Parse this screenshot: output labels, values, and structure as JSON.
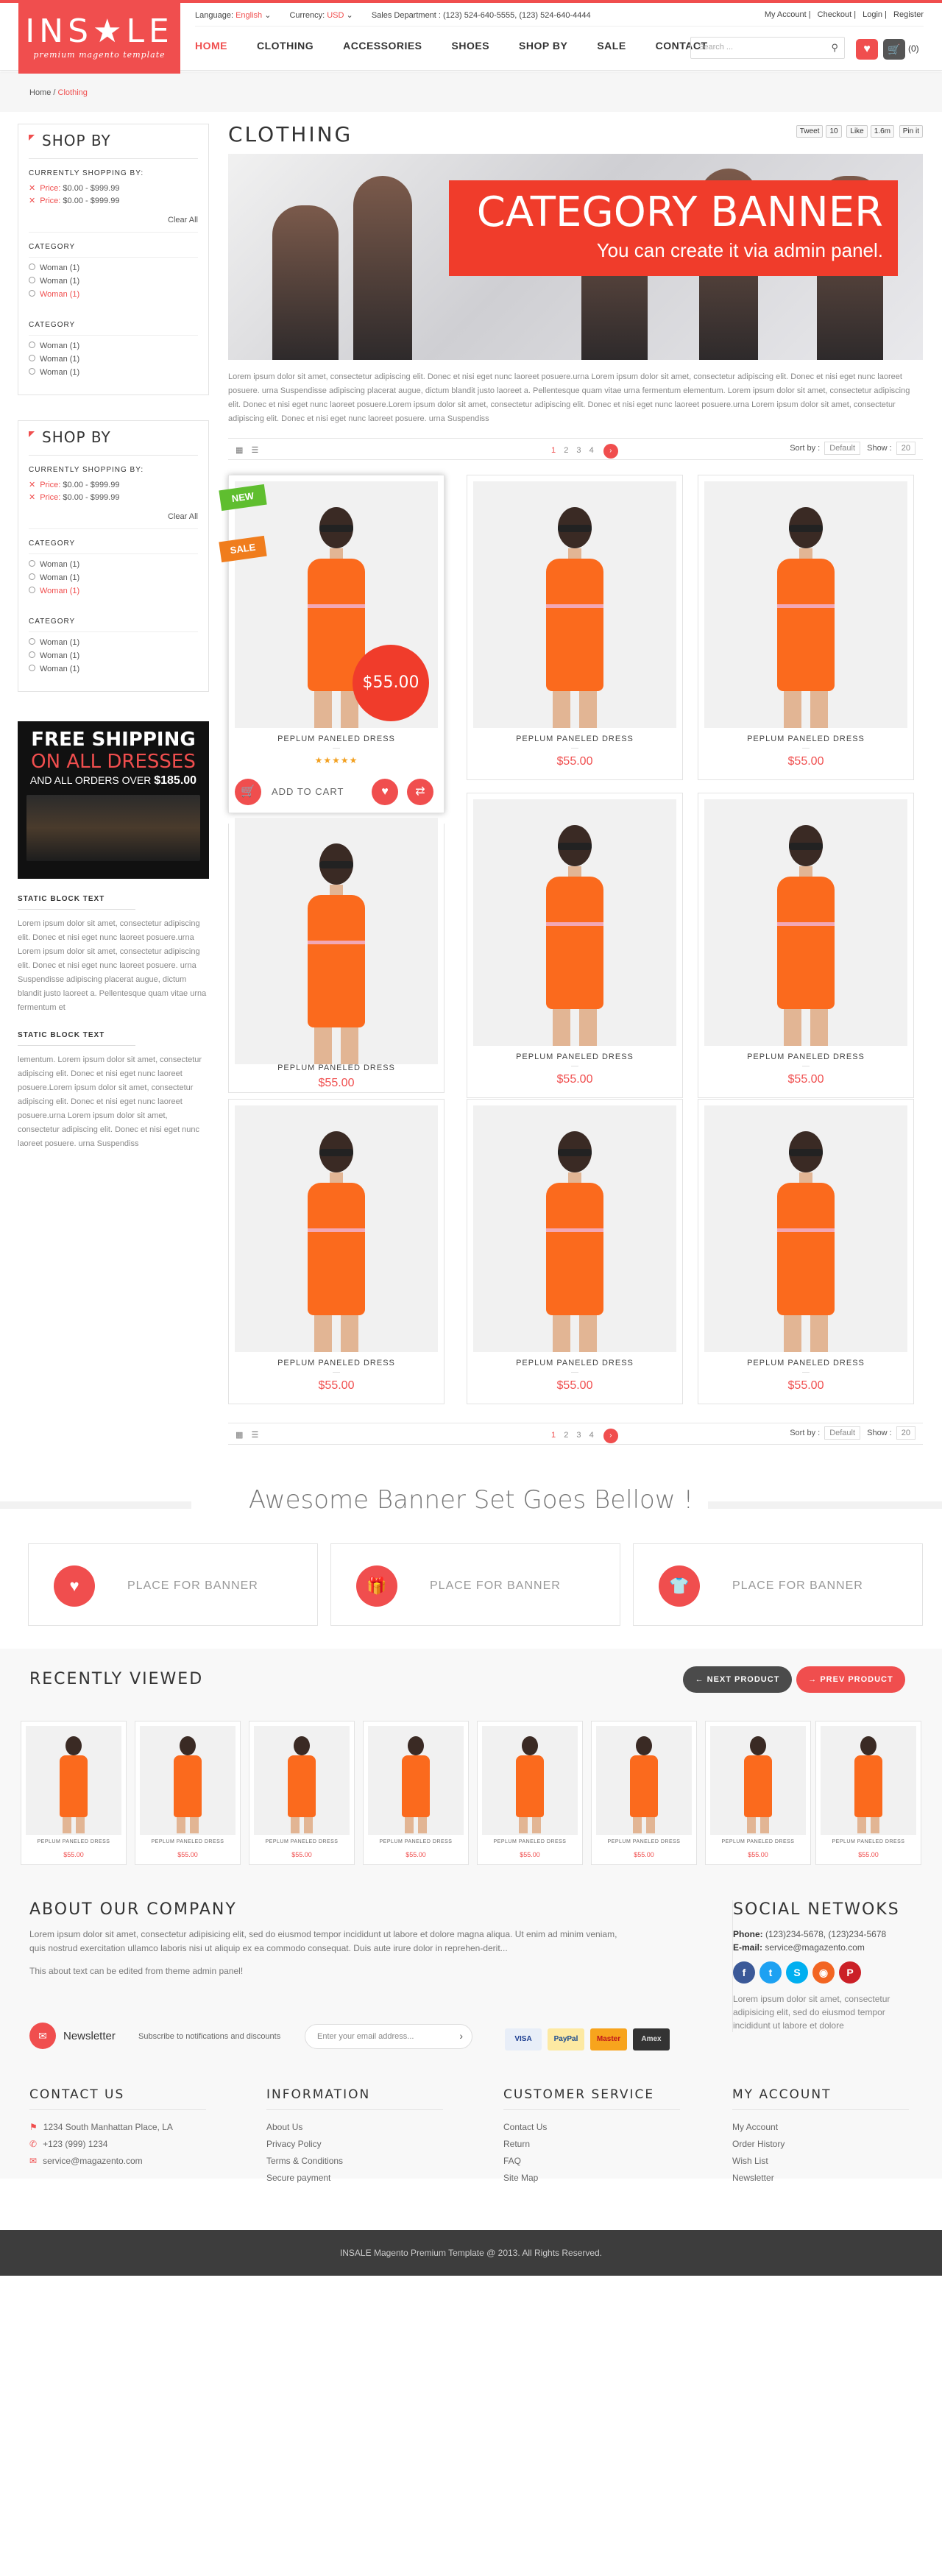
{
  "logo": {
    "title": "INS★LE",
    "subtitle": "premium magento template"
  },
  "topbar": {
    "language_label": "Language:",
    "language_value": "English",
    "currency_label": "Currency:",
    "currency_value": "USD",
    "sales": "Sales Department : (123) 524-640-5555, (123) 524-640-4444",
    "links": [
      "My Account",
      "Checkout",
      "Login",
      "Register"
    ]
  },
  "nav": [
    "HOME",
    "CLOTHING",
    "ACCESSORIES",
    "SHOES",
    "SHOP BY",
    "SALE",
    "CONTACT"
  ],
  "search": {
    "placeholder": "Search ..."
  },
  "cart": {
    "count": "(0)"
  },
  "breadcrumb": {
    "home": "Home",
    "current": "Clothing"
  },
  "sidebar": {
    "shopby_title": "SHOP BY",
    "currently": "CURRENTLY SHOPPING BY:",
    "price_label": "Price:",
    "prices": [
      "$0.00 - $999.99",
      "$0.00 - $999.99"
    ],
    "clear_all": "Clear All",
    "category_title": "CATEGORY",
    "categories": [
      "Woman (1)",
      "Woman (1)",
      "Woman (1)"
    ],
    "shipping": {
      "line1": "FREE SHIPPING",
      "line2": "ON ALL DRESSES",
      "line3": "AND ALL ORDERS OVER",
      "amount": "$185.00"
    },
    "static1_title": "STATIC BLOCK TEXT",
    "static1_text": "Lorem ipsum dolor sit amet, consectetur adipiscing elit. Donec et nisi eget nunc laoreet posuere.urna Lorem ipsum dolor sit amet, consectetur adipiscing elit. Donec et nisi eget nunc laoreet posuere. urna Suspendisse adipiscing placerat augue, dictum blandit justo laoreet a. Pellentesque quam vitae urna fermentum et",
    "static2_title": "STATIC BLOCK TEXT",
    "static2_text": "lementum. Lorem ipsum dolor sit amet, consectetur adipiscing elit. Donec et nisi eget nunc laoreet posuere.Lorem ipsum dolor sit amet, consectetur adipiscing elit. Donec et nisi eget nunc laoreet posuere.urna Lorem ipsum dolor sit amet, consectetur adipiscing elit. Donec et nisi eget nunc laoreet posuere. urna Suspendiss"
  },
  "main": {
    "title": "CLOTHING",
    "social": [
      "Tweet",
      "10",
      "Like",
      "1.6m",
      "Pin it"
    ],
    "banner_title": "CATEGORY BANNER",
    "banner_sub": "You can create it via admin panel.",
    "lorem": "Lorem ipsum dolor sit amet, consectetur adipiscing elit. Donec et nisi eget nunc laoreet posuere.urna Lorem ipsum dolor sit amet, consectetur adipiscing elit. Donec et nisi eget nunc laoreet posuere. urna Suspendisse adipiscing placerat augue, dictum blandit justo laoreet a. Pellentesque quam vitae urna fermentum elementum. Lorem ipsum dolor sit amet, consectetur adipiscing elit. Donec et nisi eget nunc laoreet posuere.Lorem ipsum dolor sit amet, consectetur adipiscing elit. Donec et nisi eget nunc laoreet posuere.urna Lorem ipsum dolor sit amet, consectetur adipiscing elit. Donec et nisi eget nunc laoreet posuere. urna Suspendiss",
    "pages": [
      "1",
      "2",
      "3",
      "4"
    ],
    "sort_label": "Sort by :",
    "sort_value": "Default",
    "show_label": "Show :",
    "show_value": "20"
  },
  "products": [
    {
      "name": "PEPLUM PANELED DRESS",
      "price": "$55.00",
      "stars": "★★★★★",
      "tag_new": "NEW",
      "tag_sale": "SALE",
      "add_to_cart": "ADD TO CART"
    },
    {
      "name": "PEPLUM PANELED DRESS",
      "price": "$55.00"
    },
    {
      "name": "PEPLUM PANELED DRESS",
      "price": "$55.00"
    },
    {
      "name": "PEPLUM PANELED DRESS",
      "price": "$55.00"
    },
    {
      "name": "PEPLUM PANELED DRESS",
      "price": "$55.00"
    },
    {
      "name": "PEPLUM PANELED DRESS",
      "price": "$55.00"
    },
    {
      "name": "PEPLUM PANELED DRESS",
      "price": "$55.00"
    },
    {
      "name": "PEPLUM PANELED DRESS",
      "price": "$55.00"
    },
    {
      "name": "PEPLUM PANELED DRESS",
      "price": "$55.00"
    }
  ],
  "awesome_title": "Awesome Banner Set Goes Bellow !",
  "banner_set": [
    "PLACE FOR BANNER",
    "PLACE FOR BANNER",
    "PLACE FOR BANNER"
  ],
  "recent": {
    "title": "RECENTLY VIEWED",
    "next": "←  NEXT PRODUCT",
    "prev": "→  PREV PRODUCT",
    "item_name": "PEPLUM PANELED DRESS",
    "item_price": "$55.00"
  },
  "about": {
    "title": "ABOUT OUR COMPANY",
    "text": "Lorem ipsum dolor sit amet, consectetur adipisicing elit, sed do eiusmod tempor incididunt ut labore et dolore magna aliqua. Ut enim ad minim veniam, quis nostrud exercitation ullamco laboris nisi ut aliquip ex ea commodo consequat. Duis aute irure dolor in reprehen-derit...",
    "note": "This about text can be edited from theme admin panel!"
  },
  "social_networks": {
    "title": "SOCIAL NETWOKS",
    "phone_label": "Phone:",
    "phone": "(123)234-5678, (123)234-5678",
    "email_label": "E-mail:",
    "email": "service@magazento.com",
    "text": "Lorem ipsum dolor sit amet, consectetur adipisicing elit, sed do eiusmod tempor incididunt ut labore et dolore"
  },
  "newsletter": {
    "title": "Newsletter",
    "sub": "Subscribe to notifications and discounts",
    "placeholder": "Enter your email address..."
  },
  "payments": [
    "VISA",
    "PayPal",
    "Master",
    "Amex"
  ],
  "footer": {
    "contact_title": "CONTACT US",
    "contact": [
      "1234 South Manhattan Place, LA",
      "+123 (999) 1234",
      "service@magazento.com"
    ],
    "info_title": "INFORMATION",
    "info": [
      "About Us",
      "Privacy Policy",
      "Terms & Conditions",
      "Secure payment"
    ],
    "cs_title": "CUSTOMER SERVICE",
    "cs": [
      "Contact Us",
      "Return",
      "FAQ",
      "Site Map"
    ],
    "acc_title": "MY ACCOUNT",
    "acc": [
      "My Account",
      "Order History",
      "Wish List",
      "Newsletter"
    ],
    "copyright": "INSALE Magento Premium Template @ 2013. All Rights Reserved."
  },
  "colors": {
    "accent": "#f04e4e",
    "dress": "#fb6a1d",
    "dark": "#3d3d3d"
  }
}
